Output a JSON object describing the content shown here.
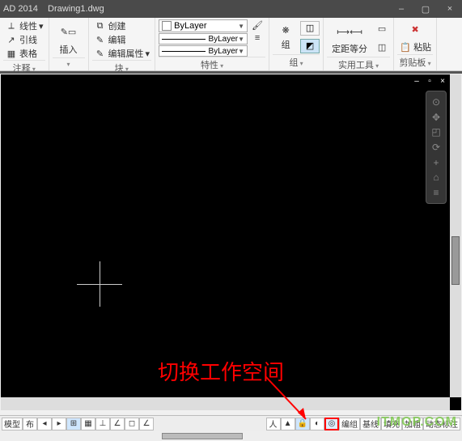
{
  "title_prefix": "AD 2014",
  "filename": "Drawing1.dwg",
  "window_controls": {
    "min": "–",
    "restore": "▢",
    "close": "×"
  },
  "ribbon": {
    "draw": {
      "line": "线性",
      "lead": "引线",
      "table": "表格",
      "label": "注释"
    },
    "insert": {
      "insert": "插入",
      "label": ""
    },
    "block": {
      "create": "创建",
      "edit": "编辑",
      "attr": "编辑属性",
      "label": "块"
    },
    "props": {
      "bylayer": "ByLayer",
      "bylayer2": "ByLayer",
      "bylayer3": "ByLayer",
      "label": "特性"
    },
    "group": {
      "group": "组",
      "label": "组"
    },
    "util": {
      "measure": "定距等分",
      "label": "实用工具"
    },
    "clip": {
      "paste": "粘贴",
      "label": "剪贴板"
    }
  },
  "annotation": "切换工作空间",
  "status": {
    "model": "模型",
    "layout1": "布",
    "ortho": "⊥",
    "workspace": "◎",
    "btns": [
      "编组",
      "基线",
      "填充",
      "加粗",
      "动态标注"
    ]
  },
  "watermark": "ITMOP.COM",
  "nav_icons": [
    "⊙",
    "✥",
    "◰",
    "⟳",
    "+",
    "⌂",
    "≡"
  ]
}
